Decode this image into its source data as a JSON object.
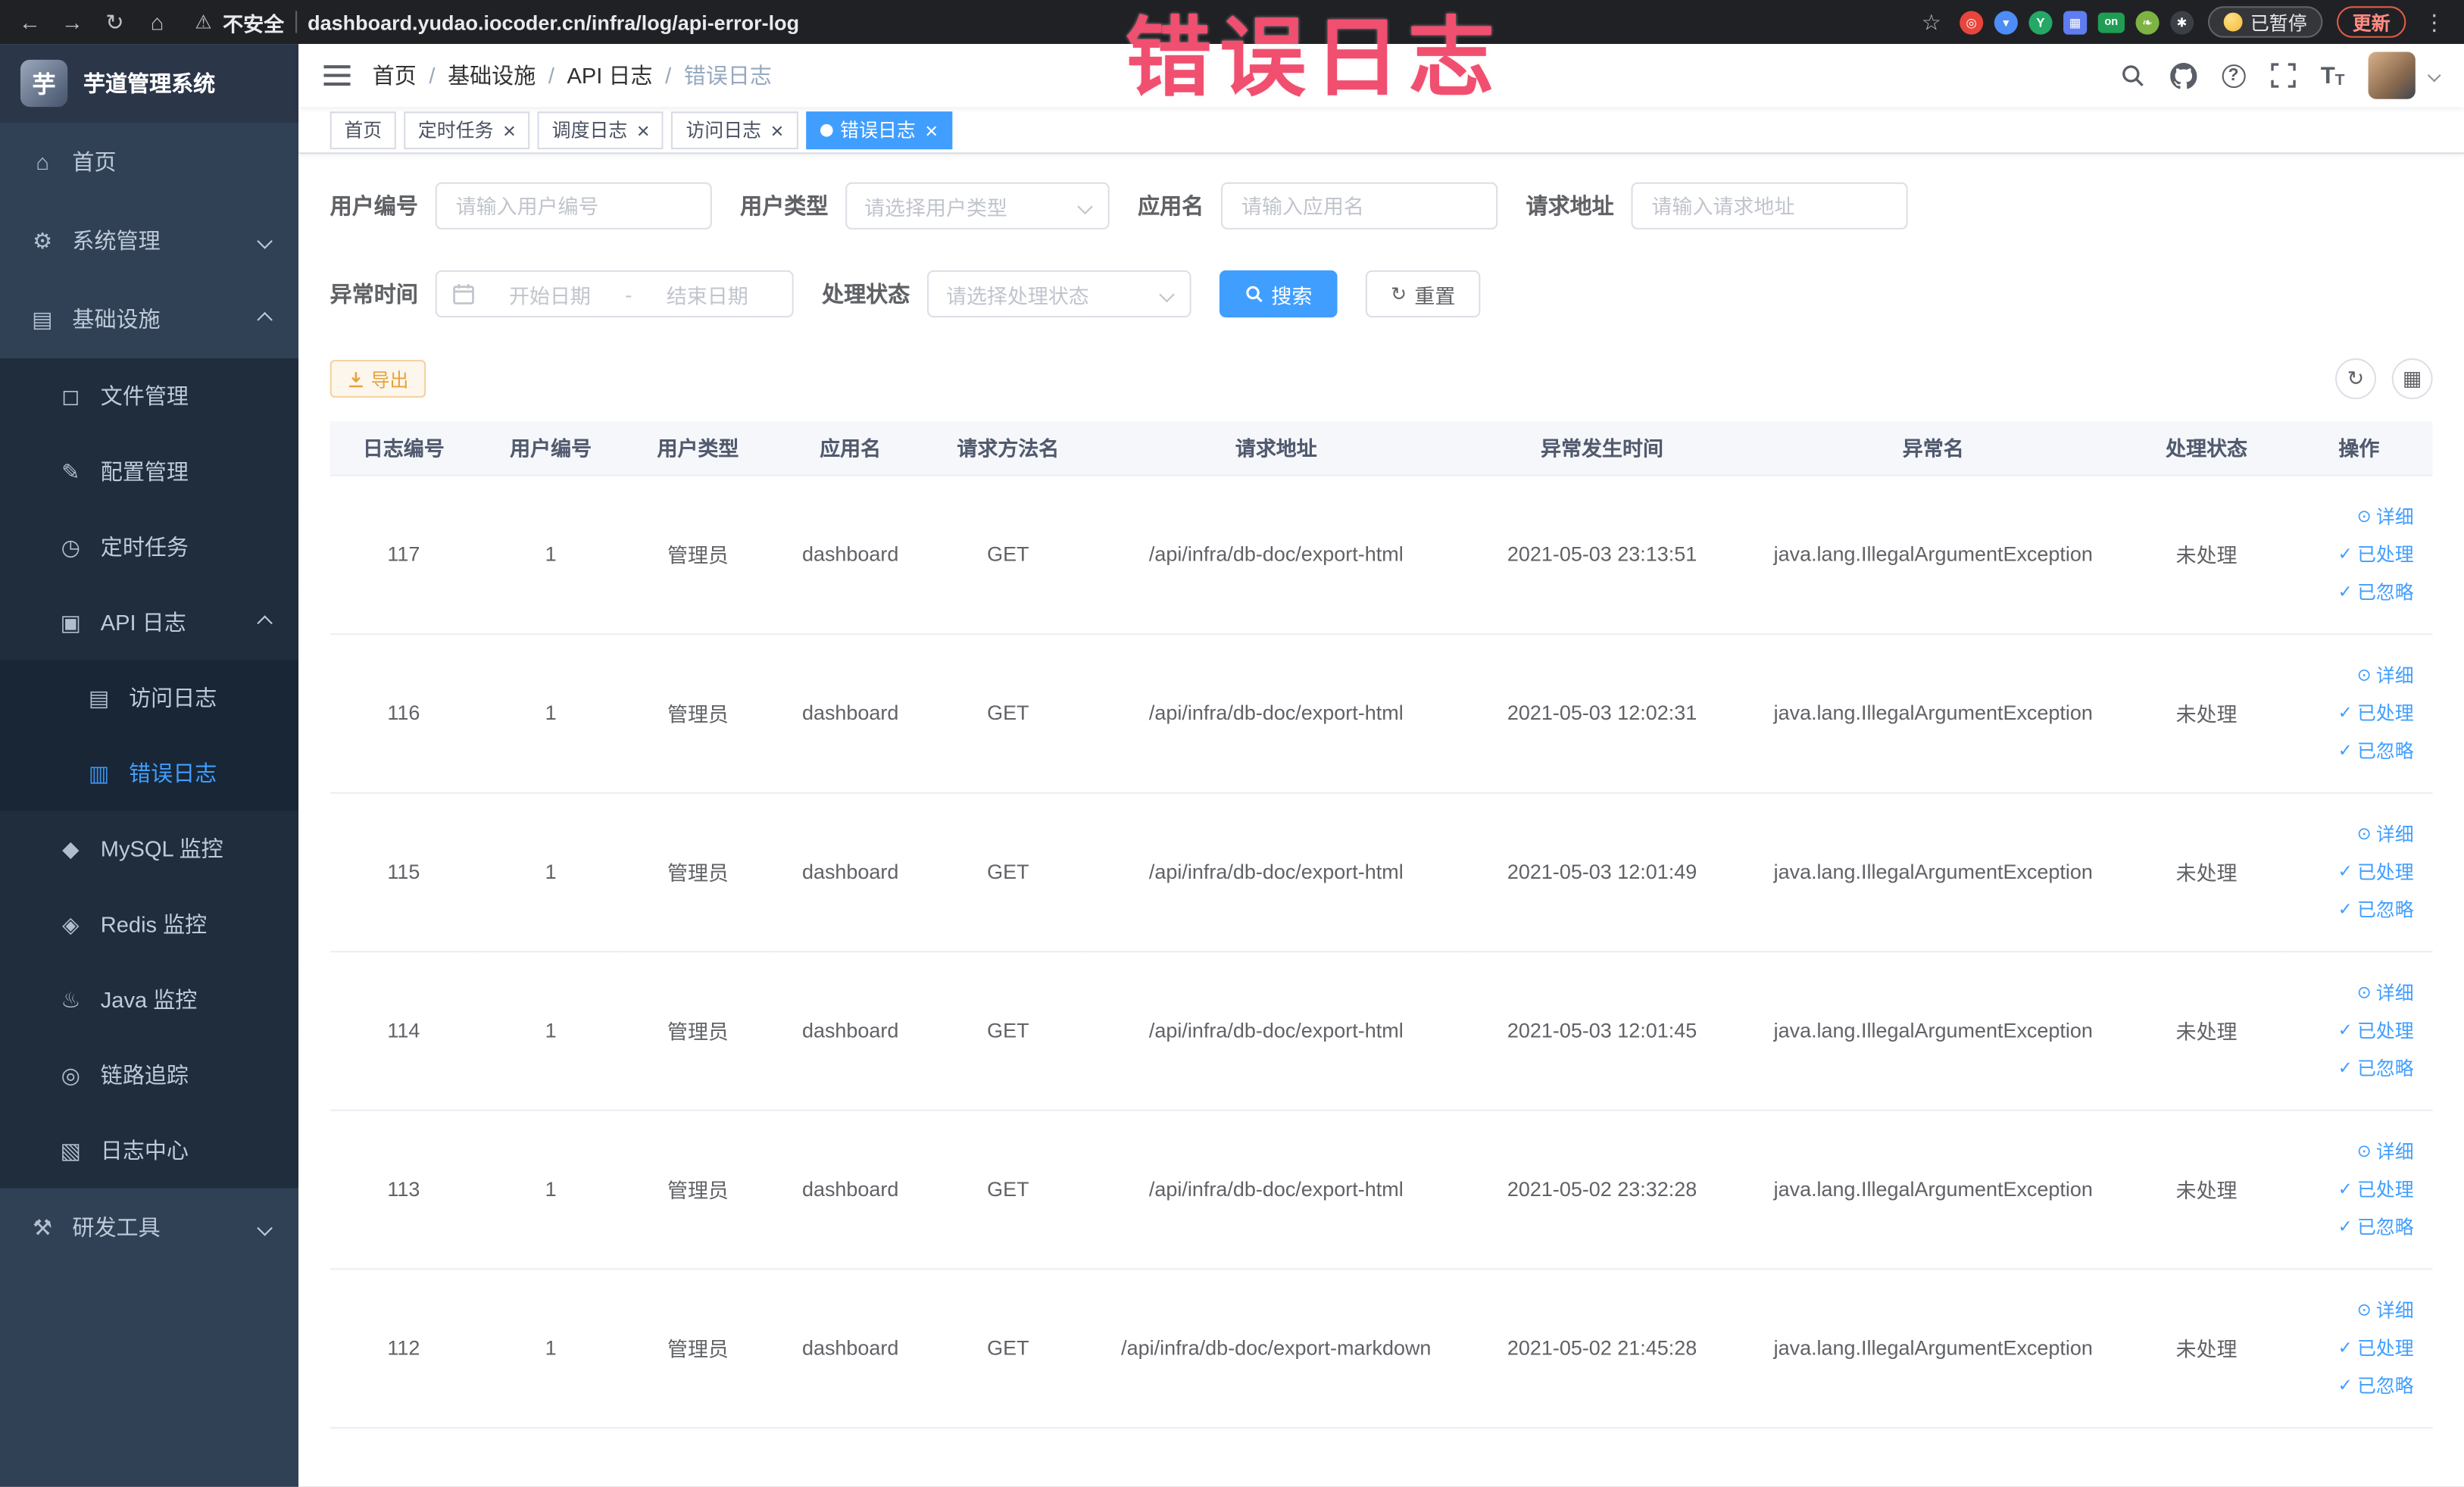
{
  "browser": {
    "security_label": "不安全",
    "url": "dashboard.yudao.iocoder.cn/infra/log/api-error-log",
    "paused_badge": "已暂停",
    "update_button": "更新",
    "extension_on_badge": "on"
  },
  "annotation": {
    "text": "错误日志",
    "color": "#f04f70"
  },
  "sidebar": {
    "title": "芋道管理系统",
    "logo_letter": "芋",
    "items": [
      {
        "name": "home",
        "label": "首页",
        "glyph": "⌂",
        "level": 0
      },
      {
        "name": "system",
        "label": "系统管理",
        "glyph": "⚙",
        "level": 0,
        "arrow": "down"
      },
      {
        "name": "infra",
        "label": "基础设施",
        "glyph": "▤",
        "level": 0,
        "arrow": "up"
      },
      {
        "name": "file-manage",
        "label": "文件管理",
        "glyph": "◻",
        "level": 1
      },
      {
        "name": "config-manage",
        "label": "配置管理",
        "glyph": "✎",
        "level": 1
      },
      {
        "name": "job",
        "label": "定时任务",
        "glyph": "◷",
        "level": 1
      },
      {
        "name": "api-log",
        "label": "API 日志",
        "glyph": "▣",
        "level": 1,
        "arrow": "up"
      },
      {
        "name": "access-log",
        "label": "访问日志",
        "glyph": "▤",
        "level": 2
      },
      {
        "name": "error-log",
        "label": "错误日志",
        "glyph": "▥",
        "level": 2,
        "active": true
      },
      {
        "name": "mysql-monitor",
        "label": "MySQL 监控",
        "glyph": "◆",
        "level": 1
      },
      {
        "name": "redis-monitor",
        "label": "Redis 监控",
        "glyph": "◈",
        "level": 1
      },
      {
        "name": "java-monitor",
        "label": "Java 监控",
        "glyph": "♨",
        "level": 1
      },
      {
        "name": "trace",
        "label": "链路追踪",
        "glyph": "◎",
        "level": 1
      },
      {
        "name": "log-center",
        "label": "日志中心",
        "glyph": "▧",
        "level": 1
      },
      {
        "name": "dev-tools",
        "label": "研发工具",
        "glyph": "⚒",
        "level": 0,
        "arrow": "down"
      }
    ]
  },
  "breadcrumb": {
    "items": [
      "首页",
      "基础设施",
      "API 日志",
      "错误日志"
    ]
  },
  "tabs": [
    {
      "name": "home",
      "label": "首页",
      "closable": false,
      "active": false
    },
    {
      "name": "job",
      "label": "定时任务",
      "closable": true,
      "active": false
    },
    {
      "name": "job-log",
      "label": "调度日志",
      "closable": true,
      "active": false
    },
    {
      "name": "access-log",
      "label": "访问日志",
      "closable": true,
      "active": false
    },
    {
      "name": "error-log",
      "label": "错误日志",
      "closable": true,
      "active": true
    }
  ],
  "filters": {
    "user_id_label": "用户编号",
    "user_id_placeholder": "请输入用户编号",
    "user_type_label": "用户类型",
    "user_type_placeholder": "请选择用户类型",
    "app_name_label": "应用名",
    "app_name_placeholder": "请输入应用名",
    "request_url_label": "请求地址",
    "request_url_placeholder": "请输入请求地址",
    "time_label": "异常时间",
    "time_start_placeholder": "开始日期",
    "time_separator": "-",
    "time_end_placeholder": "结束日期",
    "status_label": "处理状态",
    "status_placeholder": "请选择处理状态",
    "search_button": "搜索",
    "reset_button": "重置"
  },
  "toolbar": {
    "export_button": "导出"
  },
  "table": {
    "columns": [
      "日志编号",
      "用户编号",
      "用户类型",
      "应用名",
      "请求方法名",
      "请求地址",
      "异常发生时间",
      "异常名",
      "处理状态",
      "操作"
    ],
    "actions": [
      {
        "name": "detail",
        "label": "详细"
      },
      {
        "name": "processed",
        "label": "已处理"
      },
      {
        "name": "ignored",
        "label": "已忽略"
      }
    ],
    "rows": [
      {
        "id": "117",
        "user_id": "1",
        "user_type": "管理员",
        "app": "dashboard",
        "method": "GET",
        "url": "/api/infra/db-doc/export-html",
        "time": "2021-05-03 23:13:51",
        "exception": "java.lang.IllegalArgumentException",
        "status": "未处理"
      },
      {
        "id": "116",
        "user_id": "1",
        "user_type": "管理员",
        "app": "dashboard",
        "method": "GET",
        "url": "/api/infra/db-doc/export-html",
        "time": "2021-05-03 12:02:31",
        "exception": "java.lang.IllegalArgumentException",
        "status": "未处理"
      },
      {
        "id": "115",
        "user_id": "1",
        "user_type": "管理员",
        "app": "dashboard",
        "method": "GET",
        "url": "/api/infra/db-doc/export-html",
        "time": "2021-05-03 12:01:49",
        "exception": "java.lang.IllegalArgumentException",
        "status": "未处理"
      },
      {
        "id": "114",
        "user_id": "1",
        "user_type": "管理员",
        "app": "dashboard",
        "method": "GET",
        "url": "/api/infra/db-doc/export-html",
        "time": "2021-05-03 12:01:45",
        "exception": "java.lang.IllegalArgumentException",
        "status": "未处理"
      },
      {
        "id": "113",
        "user_id": "1",
        "user_type": "管理员",
        "app": "dashboard",
        "method": "GET",
        "url": "/api/infra/db-doc/export-html",
        "time": "2021-05-02 23:32:28",
        "exception": "java.lang.IllegalArgumentException",
        "status": "未处理"
      },
      {
        "id": "112",
        "user_id": "1",
        "user_type": "管理员",
        "app": "dashboard",
        "method": "GET",
        "url": "/api/infra/db-doc/export-markdown",
        "time": "2021-05-02 21:45:28",
        "exception": "java.lang.IllegalArgumentException",
        "status": "未处理"
      }
    ]
  }
}
